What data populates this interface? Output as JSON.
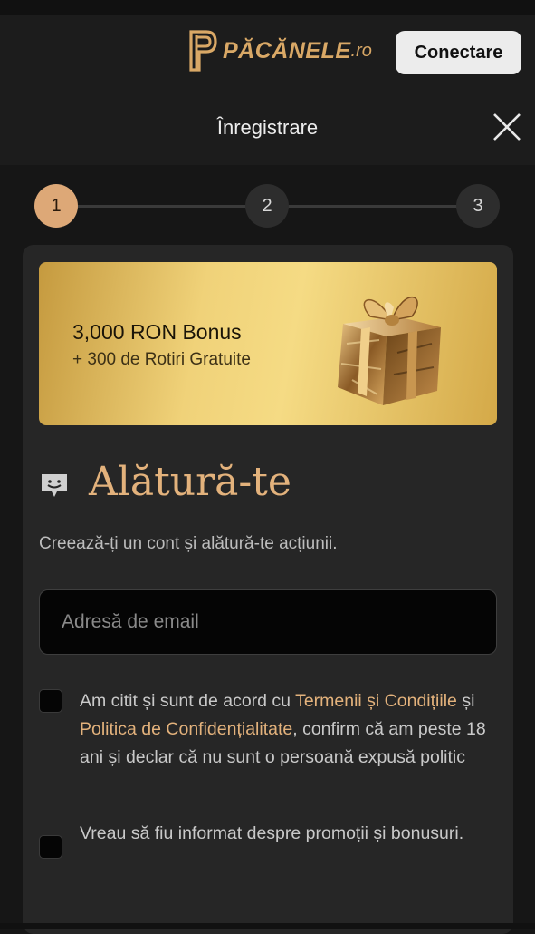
{
  "header": {
    "brand_name": "PĂCĂNELE",
    "brand_suffix": ".ro",
    "login_label": "Conectare"
  },
  "modal": {
    "title": "Înregistrare"
  },
  "stepper": {
    "steps": [
      "1",
      "2",
      "3"
    ],
    "active_step": 1
  },
  "bonus": {
    "title": "3,000 RON Bonus",
    "subtitle": "+ 300 de Rotiri Gratuite"
  },
  "join": {
    "title": "Alătură-te",
    "subtitle": "Creează-ți un cont și alătură-te acțiunii."
  },
  "form": {
    "email_placeholder": "Adresă de email",
    "email_value": ""
  },
  "consents": {
    "terms": {
      "text_1": "Am citit și sunt de acord cu ",
      "link_terms": "Termenii și Condițiile",
      "text_2": " și ",
      "link_privacy": "Politica de Confidențialitate",
      "text_3": ", confirm că am peste 18 ani și declar că nu sunt o persoană expusă politic"
    },
    "promotions": {
      "text": "Vreau să fiu informat despre promoții și bonusuri."
    }
  },
  "colors": {
    "accent": "#e3b27c",
    "step_active": "#dda877",
    "background": "#161616",
    "card": "#262626"
  },
  "icons": {
    "logo": "p-monogram-icon",
    "close": "close-icon",
    "join": "chat-smile-icon",
    "gift": "gift-box-icon"
  }
}
